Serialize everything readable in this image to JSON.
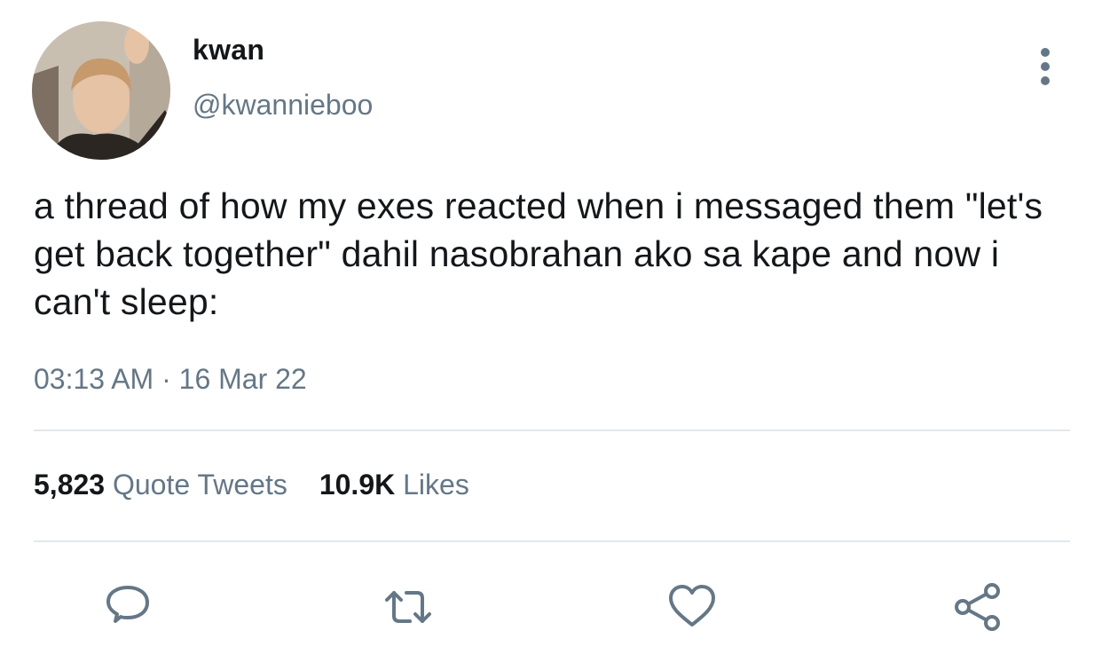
{
  "author": {
    "display_name": "kwan",
    "handle": "@kwannieboo"
  },
  "tweet": {
    "text": "a thread of how my exes reacted when i messaged them \"let's get back together\" dahil nasobrahan ako sa kape and now i can't sleep:",
    "timestamp": "03:13 AM · 16 Mar 22"
  },
  "stats": {
    "quote_tweets_count": "5,823",
    "quote_tweets_label": "Quote Tweets",
    "likes_count": "10.9K",
    "likes_label": "Likes"
  },
  "icons": {
    "more": "more-vertical-icon",
    "reply": "reply-icon",
    "retweet": "retweet-icon",
    "like": "heart-icon",
    "share": "share-icon"
  },
  "colors": {
    "text_primary": "#14171a",
    "text_secondary": "#657786",
    "divider": "#e1e8ed"
  }
}
